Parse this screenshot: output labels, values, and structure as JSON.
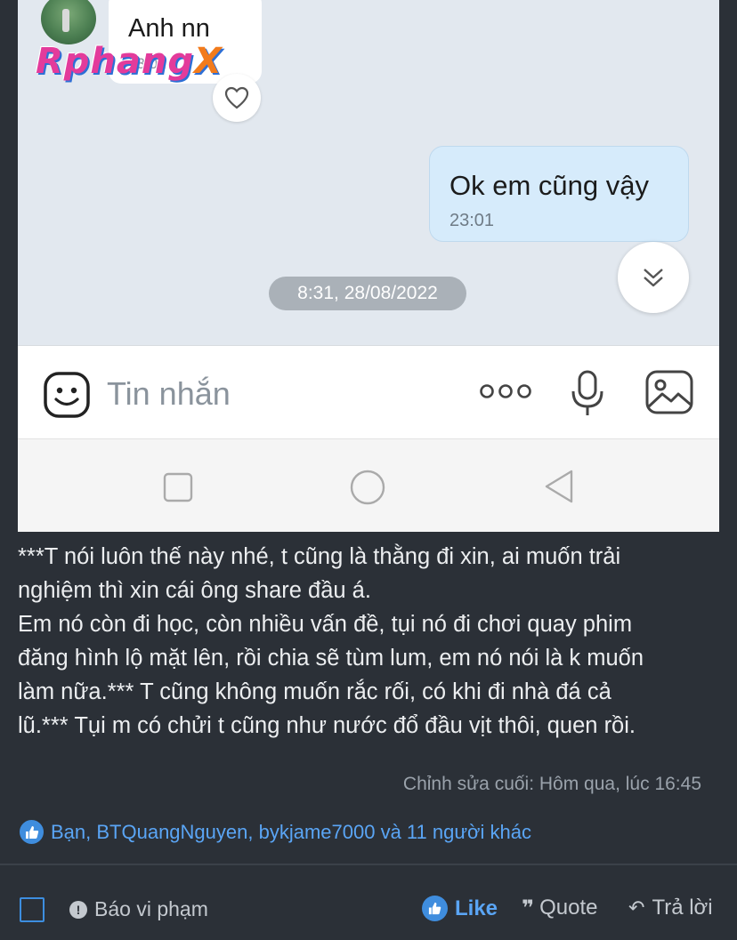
{
  "screenshot": {
    "contact_name": "Anh nn",
    "incoming_time": "23:01",
    "watermark": "RphangX",
    "outgoing_message": "Ok em cũng vậy",
    "outgoing_time": "23:01",
    "date_separator": "8:31, 28/08/2022",
    "input_placeholder": "Tin nhắn",
    "icons": {
      "heart": "heart-icon",
      "scroll_down": "chevron-double-down-icon",
      "emoji": "emoji-icon",
      "more": "more-dots-icon",
      "mic": "microphone-icon",
      "image": "image-icon",
      "nav_recent": "square-icon",
      "nav_home": "circle-icon",
      "nav_back": "triangle-back-icon"
    }
  },
  "post": {
    "paragraph1": "***T nói luôn thế này nhé, t cũng là thằng đi xin, ai muốn trải\nnghiệm thì xin cái ông share đầu á.",
    "paragraph2": "Em nó còn đi học, còn nhiều vấn đề, tụi nó đi chơi quay phim\nđăng hình lộ mặt lên, rồi chia sẽ tùm lum, em nó nói là k muốn\nlàm nữa.*** T cũng không muốn rắc rối, có khi đi nhà đá cả\nlũ.*** Tụi m có chửi t cũng như nước đổ đầu vịt thôi, quen rồi.",
    "edit_note": "Chỉnh sửa cuối: Hôm qua, lúc 16:45",
    "reactions": "Bạn, BTQuangNguyen, bykjame7000 và 11 người khác"
  },
  "footer": {
    "report_label": "Báo vi phạm",
    "like_label": "Like",
    "quote_label": "Quote",
    "reply_label": "Trả lời"
  },
  "colors": {
    "page_bg": "#2b3037",
    "link_blue": "#5aa5f5",
    "like_badge": "#3f8dde",
    "outgoing_bubble": "#d6ebfb"
  }
}
